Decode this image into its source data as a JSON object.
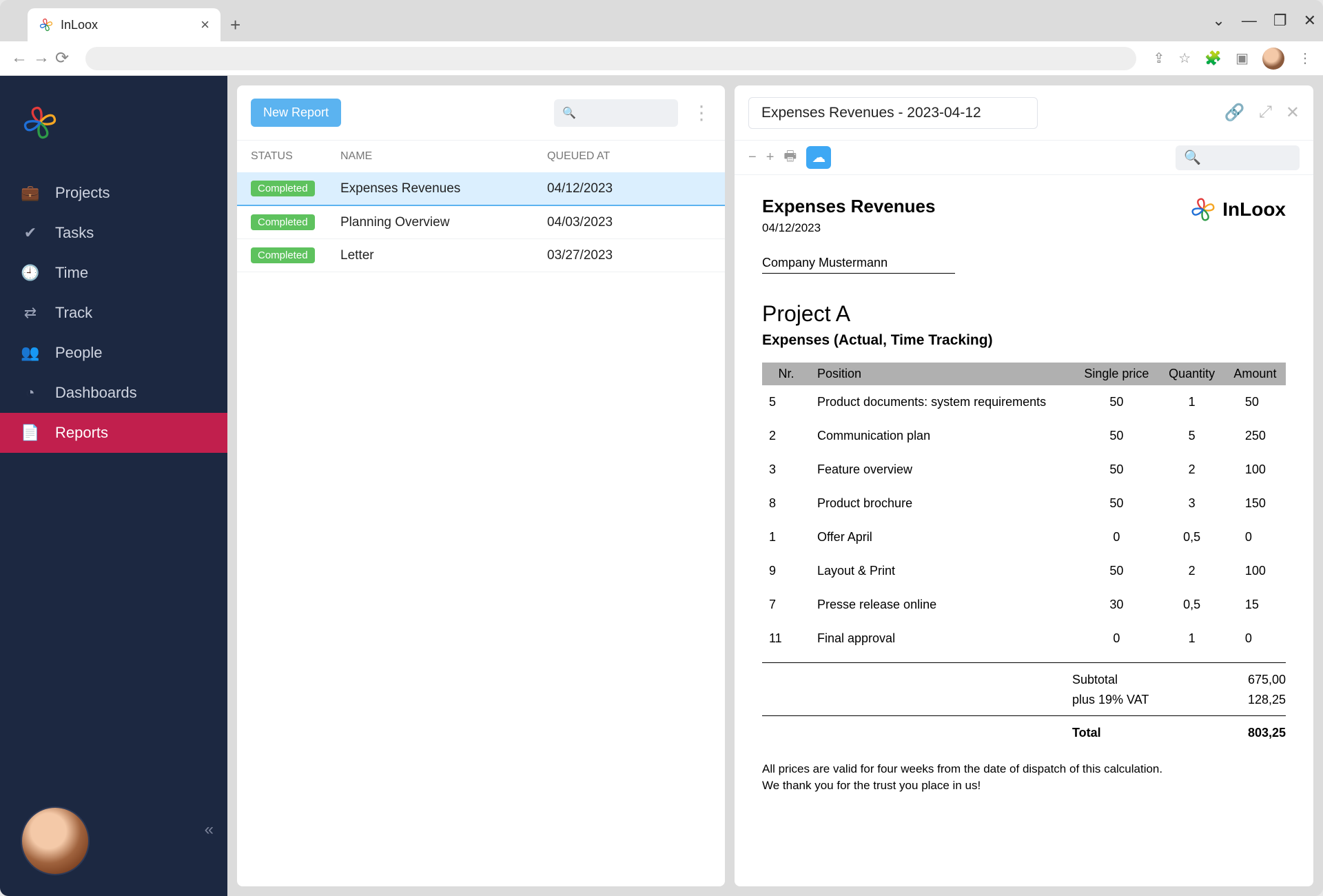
{
  "browser": {
    "tab_title": "InLoox"
  },
  "sidebar": {
    "items": [
      {
        "icon": "briefcase-icon",
        "label": "Projects"
      },
      {
        "icon": "check-circle-icon",
        "label": "Tasks"
      },
      {
        "icon": "clock-icon",
        "label": "Time"
      },
      {
        "icon": "swap-icon",
        "label": "Track"
      },
      {
        "icon": "people-icon",
        "label": "People"
      },
      {
        "icon": "piechart-icon",
        "label": "Dashboards"
      },
      {
        "icon": "report-icon",
        "label": "Reports"
      }
    ],
    "active_index": 6
  },
  "list": {
    "new_button": "New Report",
    "columns": {
      "status": "STATUS",
      "name": "NAME",
      "queued": "QUEUED AT"
    },
    "rows": [
      {
        "status": "Completed",
        "name": "Expenses Revenues",
        "queued": "04/12/2023",
        "selected": true
      },
      {
        "status": "Completed",
        "name": "Planning Overview",
        "queued": "04/03/2023",
        "selected": false
      },
      {
        "status": "Completed",
        "name": "Letter",
        "queued": "03/27/2023",
        "selected": false
      }
    ]
  },
  "detail": {
    "title": "Expenses Revenues - 2023-04-12"
  },
  "report": {
    "heading": "Expenses Revenues",
    "date": "04/12/2023",
    "brand": "InLoox",
    "company": "Company Mustermann",
    "project": "Project A",
    "subtitle": "Expenses (Actual, Time Tracking)",
    "cols": {
      "nr": "Nr.",
      "pos": "Position",
      "price": "Single price",
      "qty": "Quantity",
      "amt": "Amount"
    },
    "items": [
      {
        "nr": "5",
        "pos": "Product documents: system requirements",
        "price": "50",
        "qty": "1",
        "amt": "50"
      },
      {
        "nr": "2",
        "pos": "Communication plan",
        "price": "50",
        "qty": "5",
        "amt": "250"
      },
      {
        "nr": "3",
        "pos": "Feature overview",
        "price": "50",
        "qty": "2",
        "amt": "100"
      },
      {
        "nr": "8",
        "pos": "Product brochure",
        "price": "50",
        "qty": "3",
        "amt": "150"
      },
      {
        "nr": "1",
        "pos": "Offer April",
        "price": "0",
        "qty": "0,5",
        "amt": "0"
      },
      {
        "nr": "9",
        "pos": "Layout & Print",
        "price": "50",
        "qty": "2",
        "amt": "100"
      },
      {
        "nr": "7",
        "pos": "Presse release online",
        "price": "30",
        "qty": "0,5",
        "amt": "15"
      },
      {
        "nr": "11",
        "pos": "Final approval",
        "price": "0",
        "qty": "1",
        "amt": "0"
      }
    ],
    "subtotal_label": "Subtotal",
    "subtotal": "675,00",
    "vat_label": "plus 19% VAT",
    "vat": "128,25",
    "total_label": "Total",
    "total": "803,25",
    "footer1": "All prices are valid for four weeks from the date of dispatch of this calculation.",
    "footer2": "We thank you for the trust you place in us!"
  }
}
